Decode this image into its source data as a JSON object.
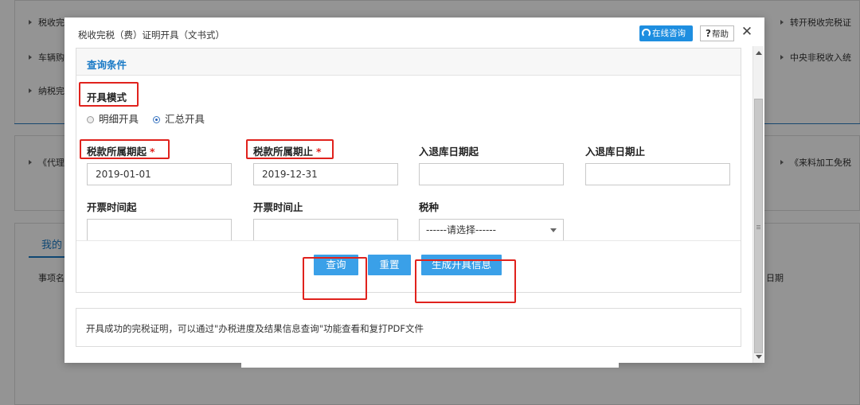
{
  "background": {
    "links_left": [
      "税收完",
      "车辆购",
      "纳税完",
      "《代理"
    ],
    "links_right": [
      "转开税收完税证",
      "中央非税收入统",
      "《来料加工免税"
    ],
    "tab_label": "我的",
    "col_left": "事项名",
    "col_right": "日期"
  },
  "dialog": {
    "title": "税收完税（费）证明开具（文书式）",
    "online_consult": "在线咨询",
    "help_label": "帮助",
    "help_q": "?",
    "close_glyph": "✕"
  },
  "query": {
    "header": "查询条件",
    "mode_label": "开具模式",
    "mode_options": [
      "明细开具",
      "汇总开具"
    ],
    "fields": {
      "tax_period_start": {
        "label": "税款所属期起",
        "value": "2019-01-01"
      },
      "tax_period_end": {
        "label": "税款所属期止",
        "value": "2019-12-31"
      },
      "storage_date_start": {
        "label": "入退库日期起",
        "value": ""
      },
      "storage_date_end": {
        "label": "入退库日期止",
        "value": ""
      },
      "invoice_time_start": {
        "label": "开票时间起",
        "value": ""
      },
      "invoice_time_end": {
        "label": "开票时间止",
        "value": ""
      },
      "tax_type": {
        "label": "税种",
        "value": "------请选择------"
      }
    },
    "required_mark": "*",
    "buttons": {
      "query": "查询",
      "reset": "重置",
      "generate": "生成开具信息"
    }
  },
  "tip": "开具成功的完税证明，可以通过\"办税进度及结果信息查询\"功能查看和复打PDF文件",
  "colors": {
    "accent_blue": "#1a7ac6",
    "button_blue": "#3aa0e8",
    "highlight_red": "#e0221d"
  }
}
